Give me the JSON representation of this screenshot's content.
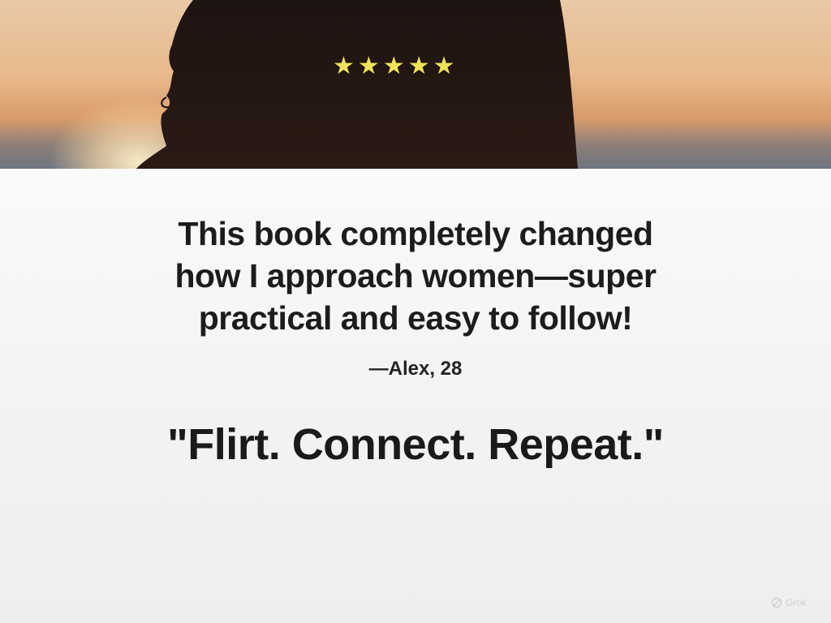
{
  "hero": {
    "image": "woman-silhouette-sunset",
    "rating": {
      "stars": 5,
      "max": 5,
      "icon": "star-icon",
      "color": "#f0e35a"
    }
  },
  "testimonial": {
    "quote_lines": [
      "This book completely changed",
      "how I approach women—super",
      "practical and easy to follow!"
    ],
    "author": "—Alex, 28"
  },
  "tagline": "\"Flirt. Connect. Repeat.\"",
  "watermark": {
    "icon": "grok-logo-icon",
    "text": "Grok"
  }
}
